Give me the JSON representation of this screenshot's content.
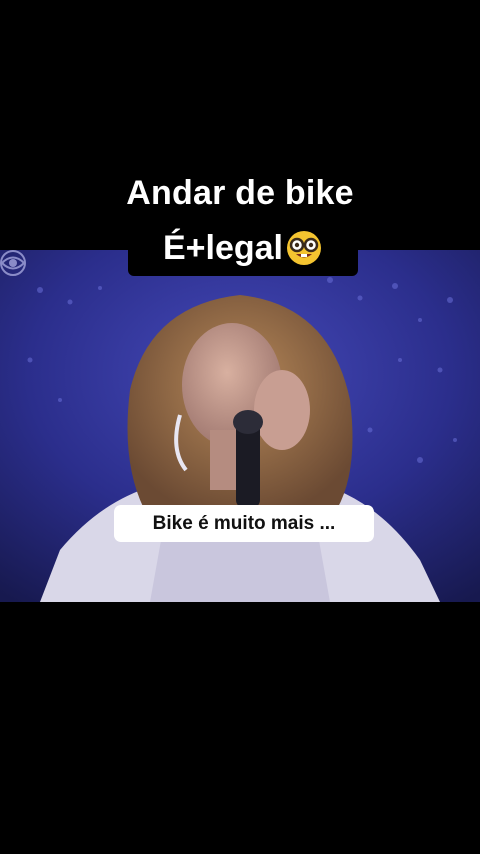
{
  "overlay": {
    "line1": "Andar de bike",
    "line2": "É+legal",
    "emoji": "nerd-face-emoji"
  },
  "bubble": {
    "text": "Bike é muito mais ..."
  },
  "video": {
    "watermark": "cbs-eye-logo-icon"
  },
  "colors": {
    "background": "#000000",
    "stage_blue": "#2a2c86",
    "caption_text": "#ffffff",
    "bubble_bg": "#ffffff",
    "bubble_text": "#111111"
  }
}
